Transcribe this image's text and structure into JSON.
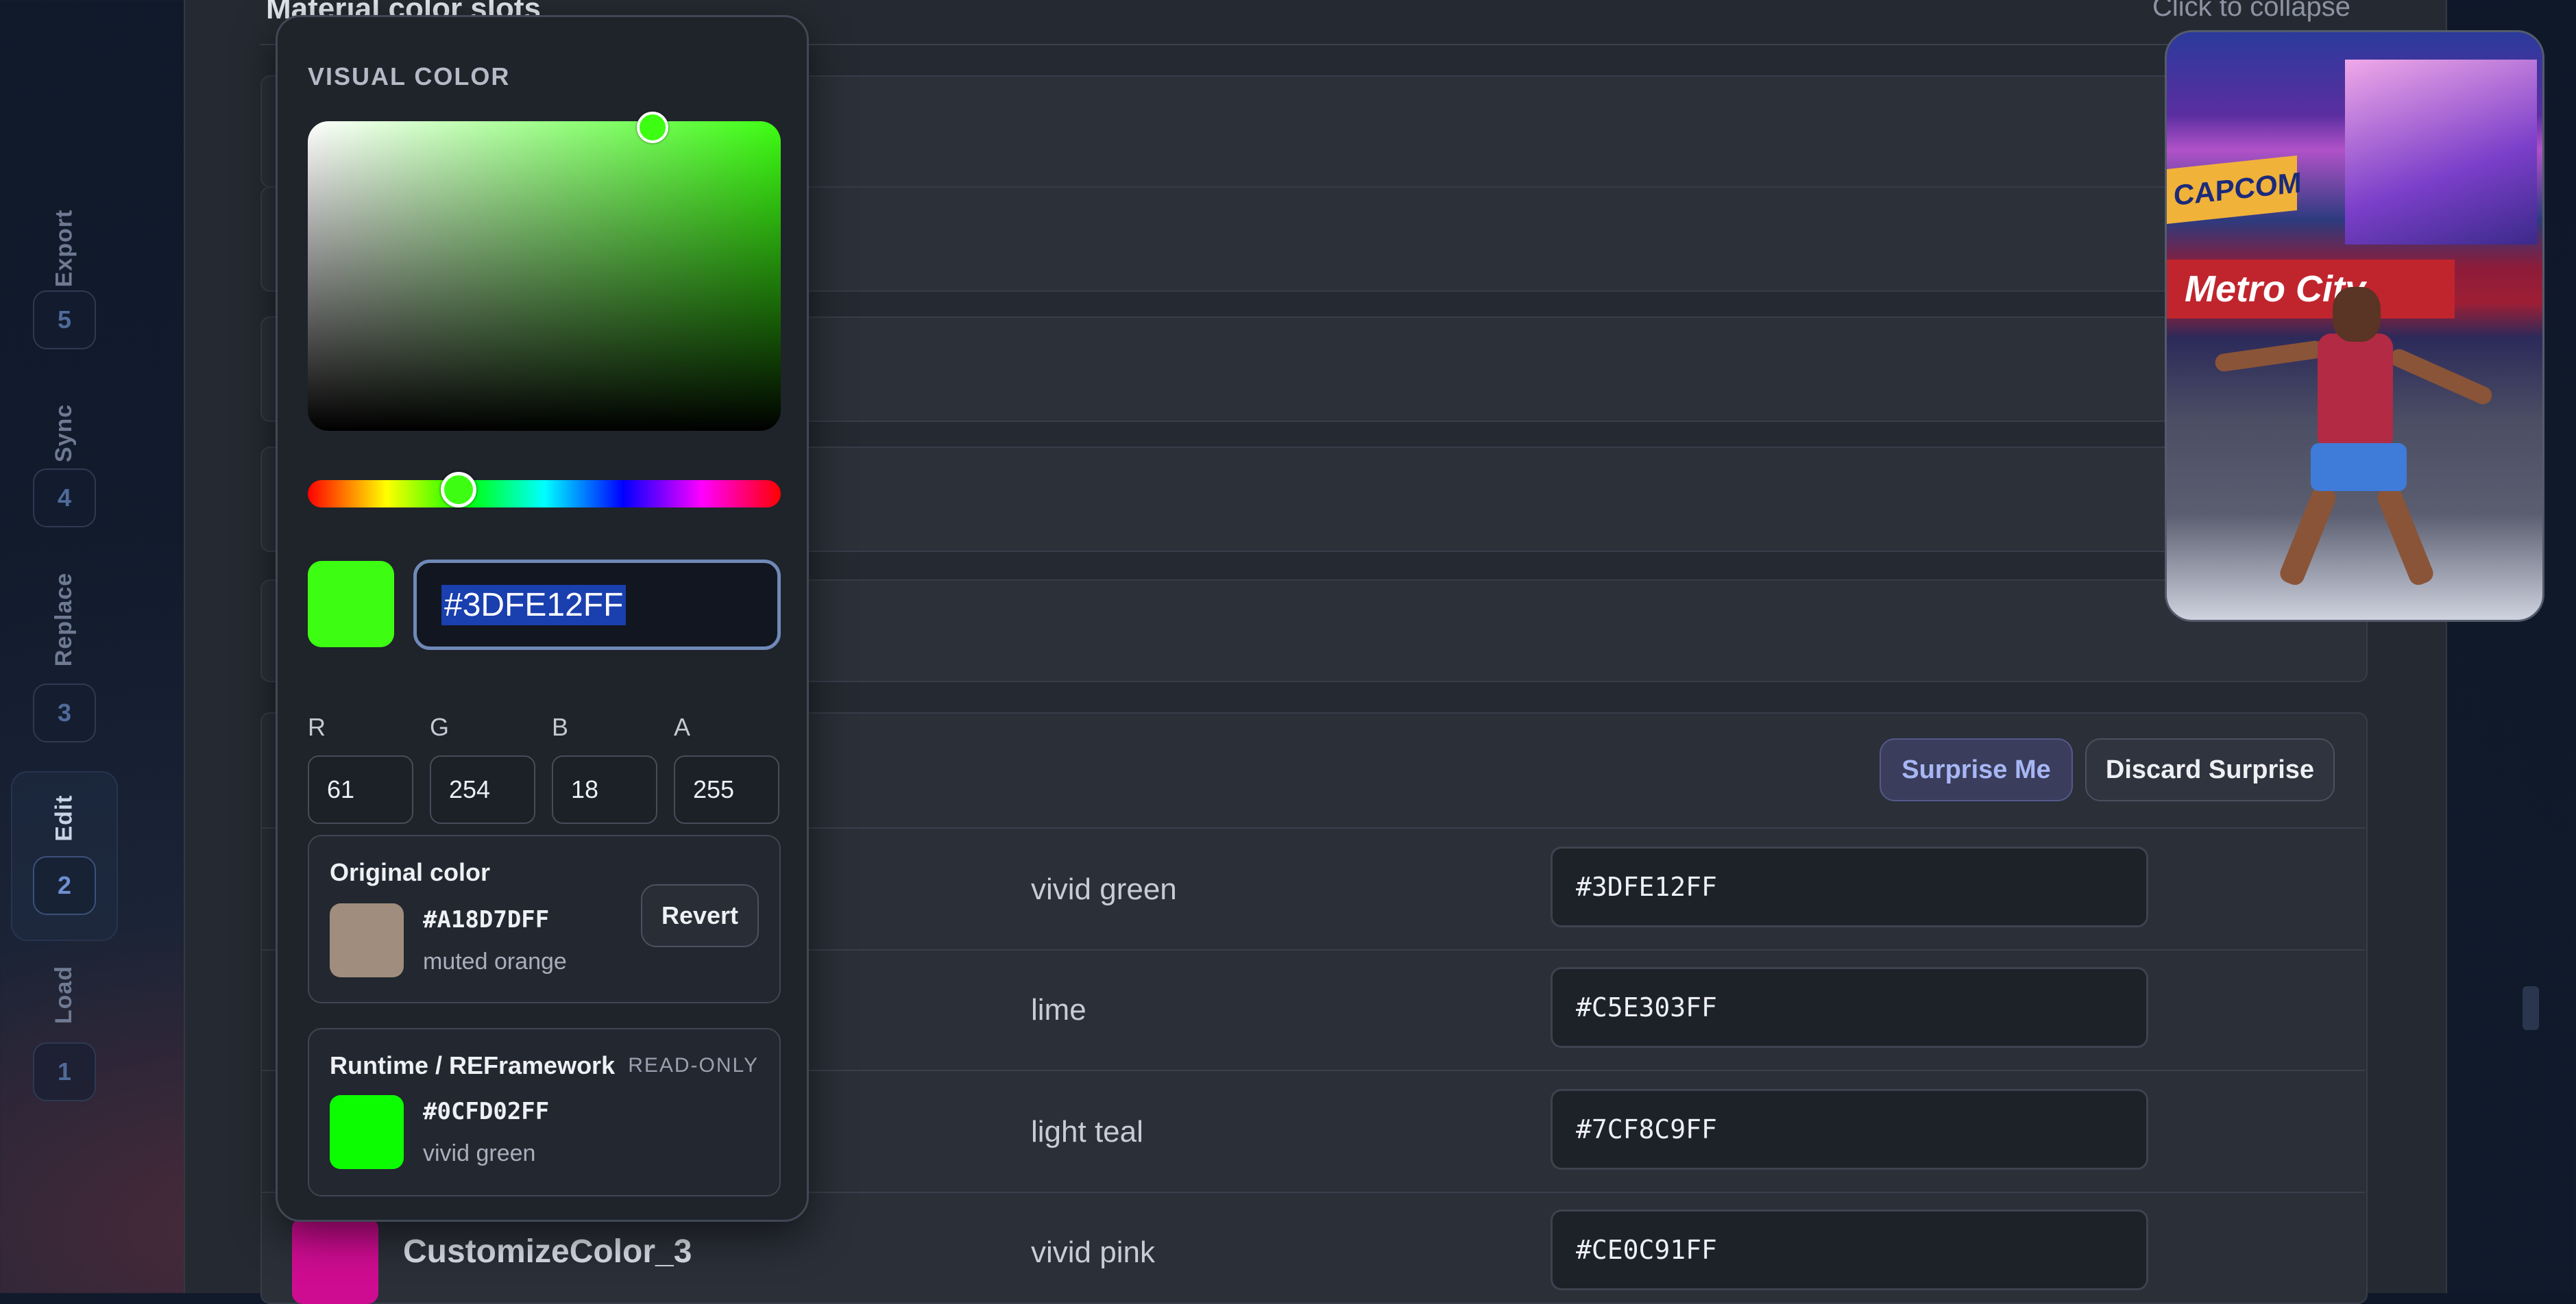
{
  "steps": [
    {
      "label": "Export",
      "num": "5"
    },
    {
      "label": "Sync",
      "num": "4"
    },
    {
      "label": "Replace",
      "num": "3"
    },
    {
      "label": "Edit",
      "num": "2",
      "active": true
    },
    {
      "label": "Load",
      "num": "1"
    }
  ],
  "section": {
    "title": "Material color slots",
    "collapse_hint": "Click to collapse"
  },
  "actions": {
    "surprise_label": "Surprise Me",
    "discard_label": "Discard Surprise"
  },
  "color_rows": [
    {
      "name": "vivid green",
      "hex": "#3DFE12FF"
    },
    {
      "name": "lime",
      "hex": "#C5E303FF"
    },
    {
      "name": "light teal",
      "hex": "#7CF8C9FF"
    },
    {
      "name": "vivid pink",
      "hex": "#CE0C91FF",
      "slot": "CustomizeColor_3",
      "swatch": "#ce0c91"
    }
  ],
  "picker": {
    "title": "VISUAL COLOR",
    "current_swatch": "#3dfe12",
    "hex_value": "#3DFE12FF",
    "channels": [
      {
        "label": "R",
        "value": "61"
      },
      {
        "label": "G",
        "value": "254"
      },
      {
        "label": "B",
        "value": "18"
      },
      {
        "label": "A",
        "value": "255"
      }
    ],
    "original": {
      "heading": "Original color",
      "hex": "#A18D7DFF",
      "name": "muted orange",
      "swatch": "#a18d7d",
      "revert_label": "Revert"
    },
    "runtime": {
      "heading": "Runtime / REFramework",
      "badge": "READ-ONLY",
      "hex": "#0CFD02FF",
      "name": "vivid green",
      "swatch": "#0cfd02"
    }
  },
  "preview": {
    "banner_text": "Metro City",
    "sign_text": "CAPCOM"
  },
  "colors": {
    "accent": "#a7b7f4",
    "hex_selection": "#1a3fae"
  }
}
